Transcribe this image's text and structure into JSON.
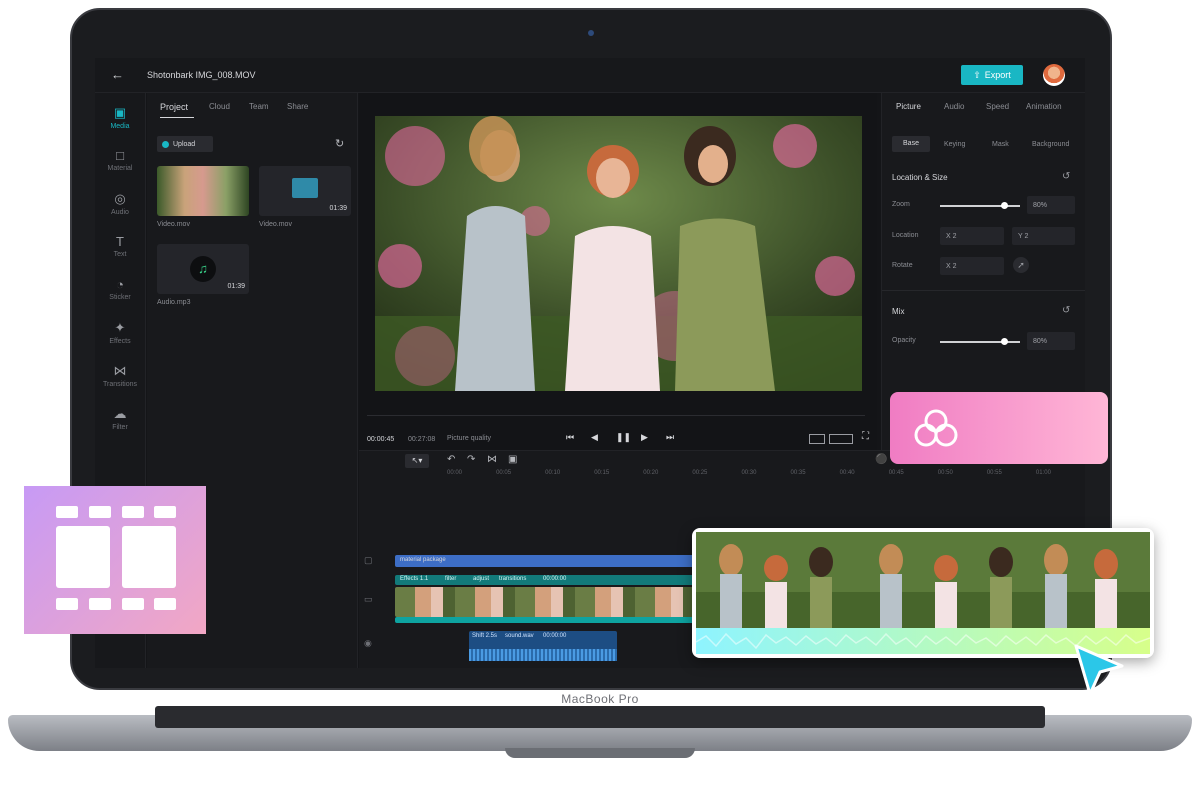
{
  "device": {
    "label": "MacBook Pro"
  },
  "topbar": {
    "filename": "Shotonbark IMG_008.MOV",
    "export_label": "Export"
  },
  "sidebar": {
    "items": [
      {
        "label": "Media",
        "icon": "media-icon"
      },
      {
        "label": "Material",
        "icon": "material-icon"
      },
      {
        "label": "Audio",
        "icon": "audio-icon"
      },
      {
        "label": "Text",
        "icon": "text-icon"
      },
      {
        "label": "Sticker",
        "icon": "sticker-icon"
      },
      {
        "label": "Effects",
        "icon": "effects-icon"
      },
      {
        "label": "Transitions",
        "icon": "transitions-icon"
      },
      {
        "label": "Filter",
        "icon": "filter-icon"
      }
    ]
  },
  "media_panel": {
    "tabs": [
      "Project",
      "Cloud",
      "Team",
      "Share"
    ],
    "upload_label": "Upload",
    "files": [
      {
        "name": "Video.mov",
        "duration": ""
      },
      {
        "name": "Video.mov",
        "duration": "01:39"
      },
      {
        "name": "Audio.mp3",
        "duration": "01:39"
      }
    ]
  },
  "player": {
    "current_time": "00:00:45",
    "total_time": "00:27:08",
    "quality_label": "Picture quality"
  },
  "inspector": {
    "tabs": [
      "Picture",
      "Audio",
      "Speed",
      "Animation"
    ],
    "subtabs": [
      "Base",
      "Keying",
      "Mask",
      "Background"
    ],
    "location_size_title": "Location & Size",
    "zoom_label": "Zoom",
    "zoom_value": "80%",
    "zoom_level": 0.8,
    "location_label": "Location",
    "location_x": "X  2",
    "location_y": "Y  2",
    "rotate_label": "Rotate",
    "rotate_value": "X  2",
    "mix_title": "Mix",
    "opacity_label": "Opacity",
    "opacity_value": "80%",
    "opacity_level": 0.8
  },
  "timeline": {
    "ticks": [
      "00:00",
      "00:05",
      "00:10",
      "00:15",
      "00:20",
      "00:25",
      "00:30",
      "00:35",
      "00:40",
      "00:45",
      "00:50",
      "00:55",
      "01:00"
    ],
    "material_track_label": "material package",
    "effects_labels": [
      "Effects 1.1",
      "filter",
      "adjust",
      "transitions",
      "00:00:00"
    ],
    "audio_labels": [
      "Shift 2.5s",
      "sound.wav",
      "00:00:00"
    ]
  },
  "colors": {
    "accent": "#19b7c4",
    "film_card": "#c79af5",
    "cloud_card": "#f07cc3",
    "pointer": "#2bc7e8"
  }
}
